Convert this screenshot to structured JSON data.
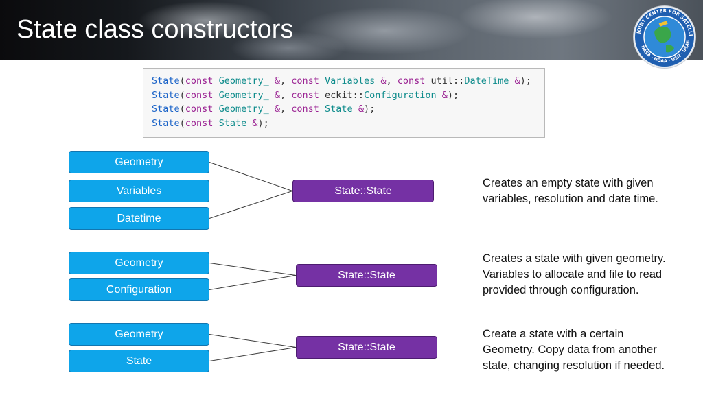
{
  "slide": {
    "title": "State class constructors"
  },
  "code": {
    "lines": [
      [
        {
          "t": "State",
          "k": "cls"
        },
        {
          "t": "(",
          "k": "pn"
        },
        {
          "t": "const",
          "k": "kw"
        },
        {
          "t": " ",
          "k": "pn"
        },
        {
          "t": "Geometry_",
          "k": "ty"
        },
        {
          "t": " ",
          "k": "pn"
        },
        {
          "t": "&",
          "k": "op"
        },
        {
          "t": ", ",
          "k": "pn"
        },
        {
          "t": "const",
          "k": "kw"
        },
        {
          "t": " ",
          "k": "pn"
        },
        {
          "t": "Variables",
          "k": "ty"
        },
        {
          "t": " ",
          "k": "pn"
        },
        {
          "t": "&",
          "k": "op"
        },
        {
          "t": ", ",
          "k": "pn"
        },
        {
          "t": "const",
          "k": "kw"
        },
        {
          "t": " ",
          "k": "pn"
        },
        {
          "t": "util::",
          "k": "id"
        },
        {
          "t": "DateTime",
          "k": "ty"
        },
        {
          "t": " ",
          "k": "pn"
        },
        {
          "t": "&",
          "k": "op"
        },
        {
          "t": ");",
          "k": "pn"
        }
      ],
      [
        {
          "t": "State",
          "k": "cls"
        },
        {
          "t": "(",
          "k": "pn"
        },
        {
          "t": "const",
          "k": "kw"
        },
        {
          "t": " ",
          "k": "pn"
        },
        {
          "t": "Geometry_",
          "k": "ty"
        },
        {
          "t": " ",
          "k": "pn"
        },
        {
          "t": "&",
          "k": "op"
        },
        {
          "t": ", ",
          "k": "pn"
        },
        {
          "t": "const",
          "k": "kw"
        },
        {
          "t": " ",
          "k": "pn"
        },
        {
          "t": "eckit::",
          "k": "id"
        },
        {
          "t": "Configuration",
          "k": "ty"
        },
        {
          "t": " ",
          "k": "pn"
        },
        {
          "t": "&",
          "k": "op"
        },
        {
          "t": ");",
          "k": "pn"
        }
      ],
      [
        {
          "t": "State",
          "k": "cls"
        },
        {
          "t": "(",
          "k": "pn"
        },
        {
          "t": "const",
          "k": "kw"
        },
        {
          "t": " ",
          "k": "pn"
        },
        {
          "t": "Geometry_",
          "k": "ty"
        },
        {
          "t": " ",
          "k": "pn"
        },
        {
          "t": "&",
          "k": "op"
        },
        {
          "t": ", ",
          "k": "pn"
        },
        {
          "t": "const",
          "k": "kw"
        },
        {
          "t": " ",
          "k": "pn"
        },
        {
          "t": "State",
          "k": "ty"
        },
        {
          "t": " ",
          "k": "pn"
        },
        {
          "t": "&",
          "k": "op"
        },
        {
          "t": ");",
          "k": "pn"
        }
      ],
      [
        {
          "t": "State",
          "k": "cls"
        },
        {
          "t": "(",
          "k": "pn"
        },
        {
          "t": "const",
          "k": "kw"
        },
        {
          "t": " ",
          "k": "pn"
        },
        {
          "t": "State",
          "k": "ty"
        },
        {
          "t": " ",
          "k": "pn"
        },
        {
          "t": "&",
          "k": "op"
        },
        {
          "t": ");",
          "k": "pn"
        }
      ]
    ]
  },
  "groups": [
    {
      "inputs": [
        "Geometry",
        "Variables",
        "Datetime"
      ],
      "ctor": "State::State",
      "description": [
        "Creates an empty state with given",
        "variables, resolution and date time."
      ]
    },
    {
      "inputs": [
        "Geometry",
        "Configuration"
      ],
      "ctor": "State::State",
      "description": [
        "Creates a state with given geometry.",
        "Variables to allocate and file to read",
        "provided through configuration."
      ]
    },
    {
      "inputs": [
        "Geometry",
        "State"
      ],
      "ctor": "State::State",
      "description": [
        "Create a state with a certain",
        "Geometry. Copy data from another",
        "state, changing resolution if needed."
      ]
    }
  ],
  "colors": {
    "input_box": "#0ea5ea",
    "constructor_box": "#7531a4",
    "connector": "#3a3a3a"
  },
  "logo": {
    "ring_text": "JOINT CENTER FOR SATELLITE DATA ASSIMILATION",
    "bottom_text": "NASA · NOAA · USN · USAF"
  }
}
